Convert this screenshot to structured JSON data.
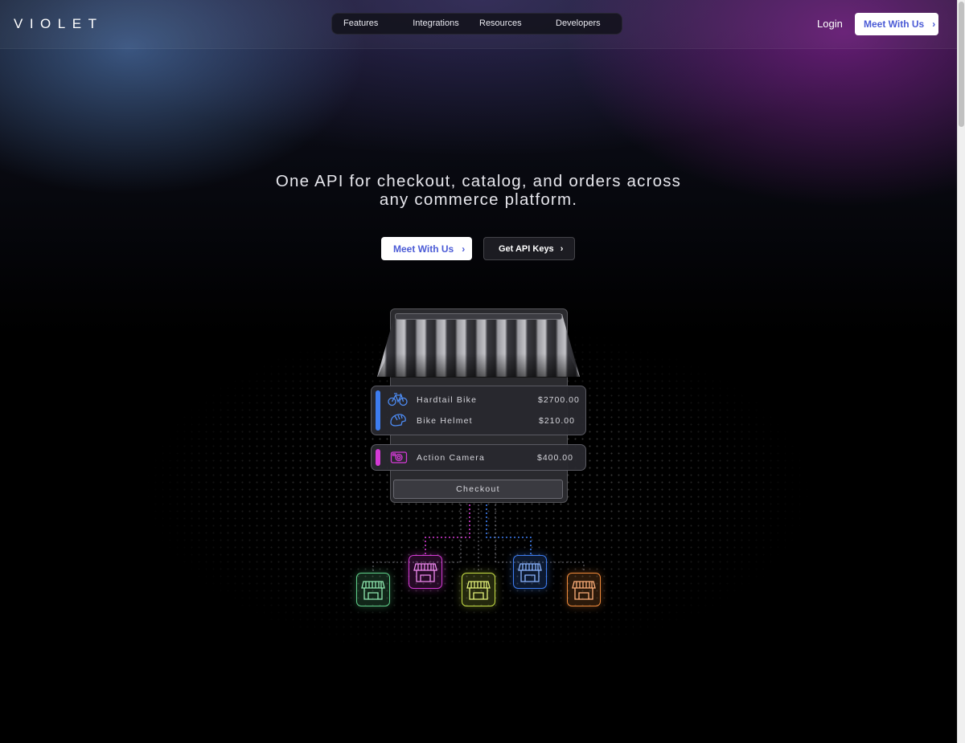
{
  "brand": {
    "logo": "VIOLET"
  },
  "nav": {
    "items": [
      "Features",
      "Integrations",
      "Resources",
      "Developers"
    ]
  },
  "header": {
    "login": "Login",
    "cta": "Meet With Us",
    "cta_chevron": "›"
  },
  "hero": {
    "headline": "One API for checkout, catalog, and orders across any commerce platform.",
    "primary_cta": "Meet With Us",
    "secondary_cta": "Get API Keys",
    "chevron": "›"
  },
  "cart": {
    "items": [
      {
        "name": "Hardtail Bike",
        "price": "$2700.00",
        "icon": "bike-icon",
        "group_color": "#3d7cf0"
      },
      {
        "name": "Bike Helmet",
        "price": "$210.00",
        "icon": "helmet-icon",
        "group_color": "#3d7cf0"
      },
      {
        "name": "Action Camera",
        "price": "$400.00",
        "icon": "camera-icon",
        "group_color": "#d43ad6"
      }
    ],
    "checkout_label": "Checkout"
  },
  "stores": [
    {
      "icon": "storefront-icon",
      "color": "#5fd08a"
    },
    {
      "icon": "storefront-icon",
      "color": "#d33ad3"
    },
    {
      "icon": "storefront-icon",
      "color": "#c8e046"
    },
    {
      "icon": "storefront-icon",
      "color": "#3d7cf0"
    },
    {
      "icon": "storefront-icon",
      "color": "#f08a3a"
    }
  ],
  "colors": {
    "accent": "#4b5bd6",
    "magenta": "#d33ad3",
    "blue": "#3d7cf0"
  }
}
